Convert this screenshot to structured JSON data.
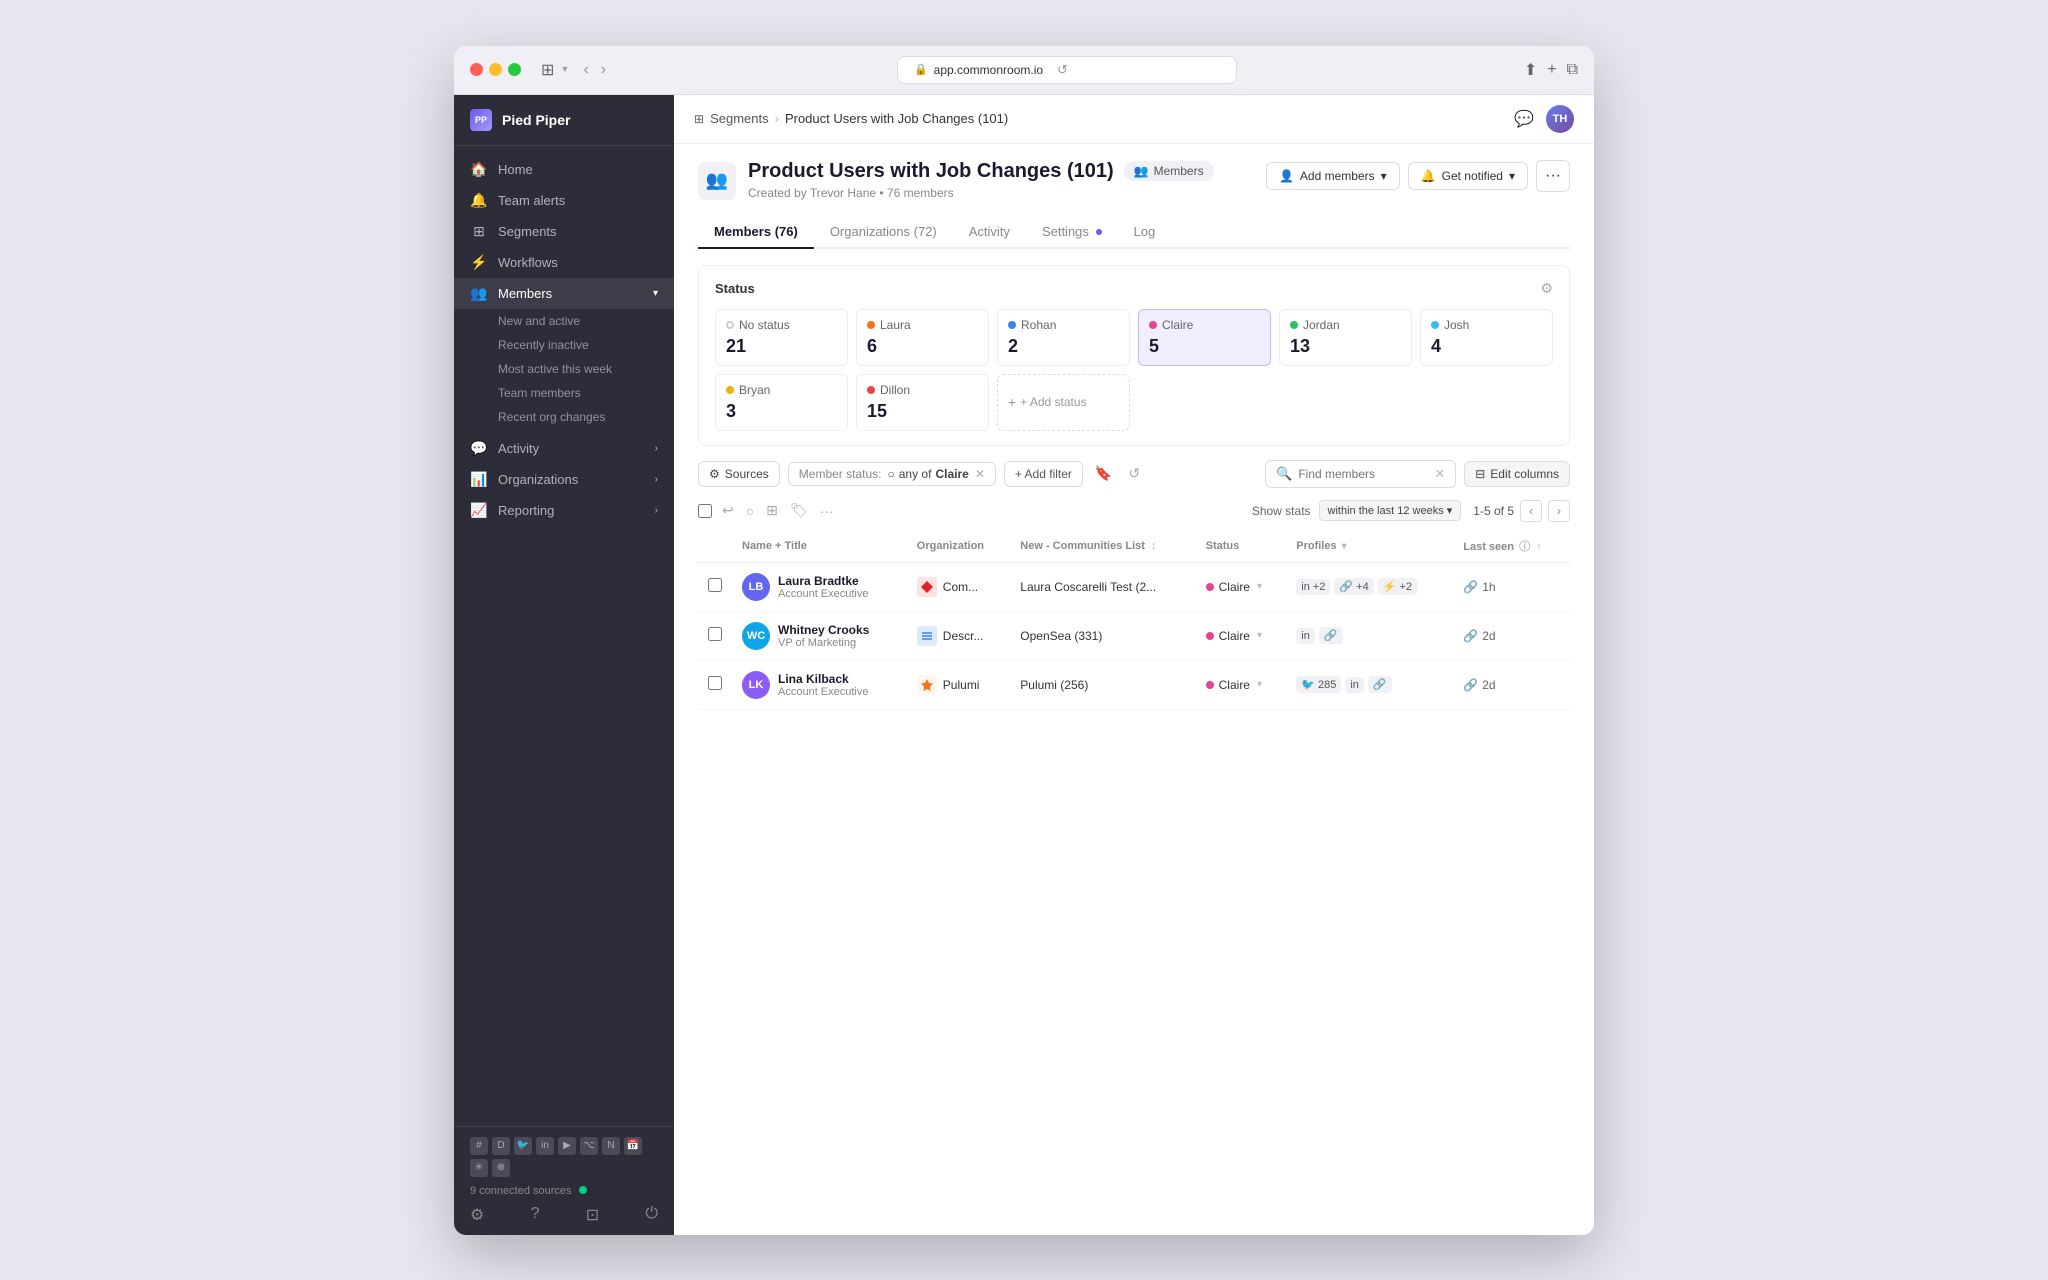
{
  "browser": {
    "url": "app.commonroom.io",
    "title": "Product Users with Job Changes"
  },
  "sidebar": {
    "logo": "Pied Piper",
    "logo_icon": "PP",
    "nav_items": [
      {
        "label": "Home",
        "icon": "🏠",
        "active": false
      },
      {
        "label": "Team alerts",
        "icon": "🔔",
        "active": false
      },
      {
        "label": "Segments",
        "icon": "⊞",
        "active": false
      },
      {
        "label": "Workflows",
        "icon": "⚡",
        "active": false
      },
      {
        "label": "Members",
        "icon": "👥",
        "active": true,
        "expanded": true
      }
    ],
    "members_sub": [
      {
        "label": "New and active",
        "active": false
      },
      {
        "label": "Recently inactive",
        "active": false
      },
      {
        "label": "Most active this week",
        "active": false
      },
      {
        "label": "Team members",
        "active": false
      },
      {
        "label": "Recent org changes",
        "active": false
      }
    ],
    "nav_items_bottom": [
      {
        "label": "Activity",
        "icon": "💬",
        "has_chevron": true
      },
      {
        "label": "Organizations",
        "icon": "📊",
        "has_chevron": true
      },
      {
        "label": "Reporting",
        "icon": "📈",
        "has_chevron": true
      }
    ],
    "connected_label": "9 connected sources",
    "footer_icons": [
      "⚙",
      "?",
      "⊡",
      "⏻"
    ]
  },
  "breadcrumb": {
    "parent": "Segments",
    "current": "Product Users with Job Changes (101)"
  },
  "page": {
    "title": "Product Users with Job Changes (101)",
    "members_badge": "Members",
    "subtitle_created": "Created by Trevor Hane",
    "subtitle_count": "76 members",
    "add_members_label": "Add members",
    "get_notified_label": "Get notified"
  },
  "tabs": [
    {
      "label": "Members (76)",
      "active": true
    },
    {
      "label": "Organizations (72)",
      "active": false
    },
    {
      "label": "Activity",
      "active": false
    },
    {
      "label": "Settings",
      "active": false,
      "has_dot": true
    },
    {
      "label": "Log",
      "active": false
    }
  ],
  "status_section": {
    "title": "Status",
    "items": [
      {
        "name": "No status",
        "count": 21,
        "color": null,
        "style": "ring"
      },
      {
        "name": "Laura",
        "count": 6,
        "color": "#f97316"
      },
      {
        "name": "Rohan",
        "count": 2,
        "color": "#3b82f6"
      },
      {
        "name": "Claire",
        "count": 5,
        "color": "#e84393",
        "selected": true
      },
      {
        "name": "Jordan",
        "count": 13,
        "color": "#22c55e"
      },
      {
        "name": "Josh",
        "count": 4,
        "color": "#38bdf8"
      }
    ],
    "row2": [
      {
        "name": "Bryan",
        "count": 3,
        "color": "#eab308"
      },
      {
        "name": "Dillon",
        "count": 15,
        "color": "#ef4444"
      },
      {
        "add": true,
        "label": "+ Add status"
      }
    ]
  },
  "filters": {
    "sources_label": "Sources",
    "member_status_label": "Member status:",
    "member_status_prefix": "any of",
    "member_status_value": "Claire",
    "add_filter_label": "+ Add filter",
    "search_placeholder": "Find members",
    "edit_columns_label": "Edit columns"
  },
  "table": {
    "stats_label": "Show stats",
    "stats_within": "within the last 12 weeks",
    "pagination": "1-5 of 5",
    "columns": [
      {
        "label": "Name + Title"
      },
      {
        "label": "Organization"
      },
      {
        "label": "New - Communities List"
      },
      {
        "label": "Status"
      },
      {
        "label": "Profiles"
      },
      {
        "label": "Last seen"
      }
    ],
    "rows": [
      {
        "name": "Laura Bradtke",
        "title": "Account Executive",
        "avatar_bg": "#6366f1",
        "avatar_initials": "LB",
        "org": "Com...",
        "org_color": "#dc2626",
        "org_shape": "diamond",
        "communities": "Laura Coscarelli Test (2...",
        "status": "Claire",
        "status_color": "#e84393",
        "profiles": [
          "in +2",
          "🔗 +4",
          "⚡ +2"
        ],
        "last_seen": "1h"
      },
      {
        "name": "Whitney Crooks",
        "title": "VP of Marketing",
        "avatar_bg": "#0ea5e9",
        "avatar_initials": "WC",
        "org": "Descr...",
        "org_color": "#3b82f6",
        "org_shape": "lines",
        "communities": "OpenSea (331)",
        "status": "Claire",
        "status_color": "#e84393",
        "profiles": [
          "in",
          "🔗"
        ],
        "last_seen": "2d"
      },
      {
        "name": "Lina Kilback",
        "title": "Account Executive",
        "avatar_bg": "#8b5cf6",
        "avatar_initials": "LK",
        "org": "Pulumi",
        "org_color": "#f97316",
        "org_shape": "star",
        "communities": "Pulumi (256)",
        "status": "Claire",
        "status_color": "#e84393",
        "profiles": [
          "🐦 285",
          "in",
          "🔗"
        ],
        "last_seen": "2d"
      }
    ]
  }
}
